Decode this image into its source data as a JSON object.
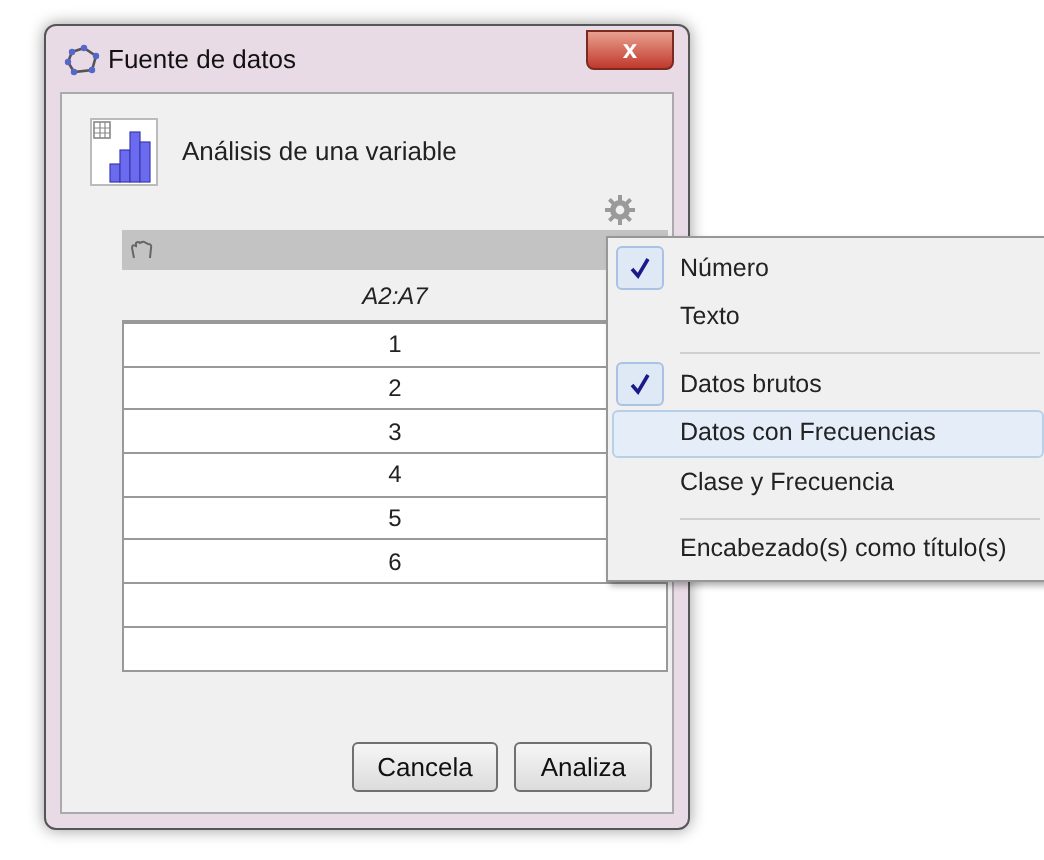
{
  "window": {
    "title": "Fuente de datos",
    "close": "x"
  },
  "header": {
    "title": "Análisis de una variable"
  },
  "table": {
    "column": "A2:A7",
    "rows": [
      {
        "kind": "value",
        "value": "1"
      },
      {
        "kind": "value",
        "value": "2"
      },
      {
        "kind": "value",
        "value": "3"
      },
      {
        "kind": "value",
        "value": "4"
      },
      {
        "kind": "value",
        "value": "5"
      },
      {
        "kind": "value",
        "value": "6"
      },
      {
        "kind": "blank"
      },
      {
        "kind": "blank"
      }
    ]
  },
  "buttons": [
    "Cancela",
    "Analiza"
  ],
  "menu": [
    {
      "kind": "item",
      "label": "Número",
      "checked": true,
      "selected": false
    },
    {
      "kind": "item",
      "label": "Texto",
      "checked": false,
      "selected": false
    },
    {
      "kind": "separator"
    },
    {
      "kind": "item",
      "label": "Datos brutos",
      "checked": true,
      "selected": false
    },
    {
      "kind": "item",
      "label": "Datos con Frecuencias",
      "checked": false,
      "selected": true
    },
    {
      "kind": "item",
      "label": "Clase y Frecuencia",
      "checked": false,
      "selected": false
    },
    {
      "kind": "separator"
    },
    {
      "kind": "item",
      "label": "Encabezado(s) como título(s)",
      "checked": false,
      "selected": false
    }
  ]
}
